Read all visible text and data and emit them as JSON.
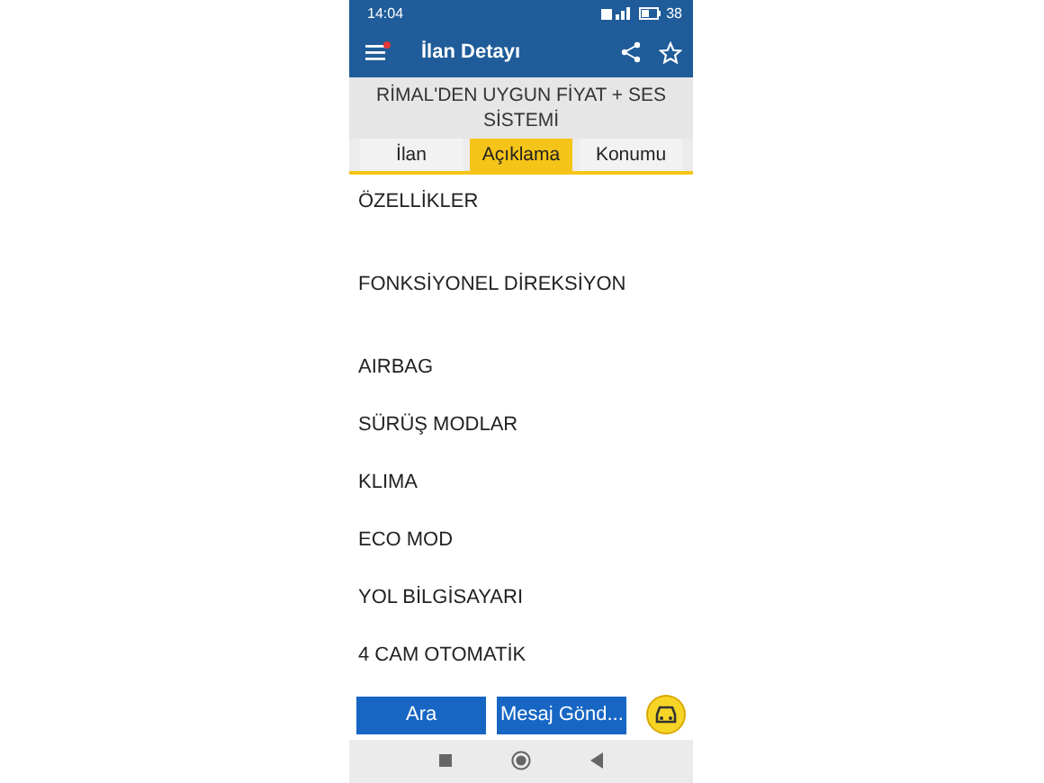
{
  "status_bar": {
    "time": "14:04",
    "battery": "38"
  },
  "app_bar": {
    "title": "İlan Detayı",
    "has_notification": true
  },
  "listing_title": "RİMAL'DEN UYGUN FİYAT + SES SİSTEMİ",
  "tabs": [
    {
      "label": "İlan",
      "selected": false
    },
    {
      "label": "Açıklama",
      "selected": true
    },
    {
      "label": "Konumu",
      "selected": false
    }
  ],
  "features": [
    "ÖZELLİKLER",
    "FONKSİYONEL DİREKSİYON",
    "AIRBAG",
    "SÜRÜŞ MODLAR",
    "KLIMA",
    "ECO MOD",
    "YOL BİLGİSAYARI",
    "4 CAM OTOMATİK"
  ],
  "buttons": [
    "Ara",
    "Mesaj Gönd..."
  ]
}
